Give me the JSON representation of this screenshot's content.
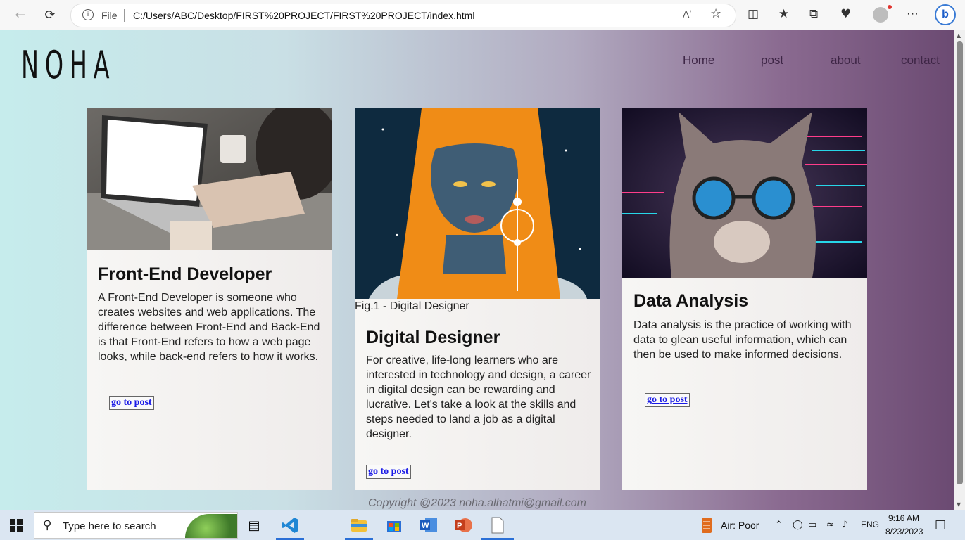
{
  "browser": {
    "back_icon": "back-arrow-icon",
    "refresh_icon": "refresh-icon",
    "scheme_label": "File",
    "url": "C:/Users/ABC/Desktop/FIRST%20PROJECT/FIRST%20PROJECT/index.html",
    "read_aloud_label": "Aʼ"
  },
  "site": {
    "logo": "NOHA",
    "nav": [
      "Home",
      "post",
      "about",
      "contact"
    ],
    "cards": [
      {
        "title": "Front-End Developer",
        "text": "A Front-End Developer is someone who creates websites and web applications. The difference between Front-End and Back-End is that Front-End refers to how a web page looks, while back-end refers to how it works.",
        "button": "go to post"
      },
      {
        "caption": "Fig.1 - Digital Designer",
        "title": "Digital Designer",
        "text": "For creative, life-long learners who are interested in technology and design, a career in digital design can be rewarding and lucrative. Let's take a look at the skills and steps needed to land a job as a digital designer.",
        "button": "go to post"
      },
      {
        "title": "Data Analysis",
        "text": "Data analysis is the practice of working with data to glean useful information, which can then be used to make informed decisions.",
        "button": "go to post"
      }
    ],
    "copyright": "Copyright @2023 noha.alhatmi@gmail.com"
  },
  "taskbar": {
    "search_placeholder": "Type here to search",
    "weather": "Air: Poor",
    "language": "ENG",
    "time": "9:16 AM",
    "date": "8/23/2023"
  }
}
